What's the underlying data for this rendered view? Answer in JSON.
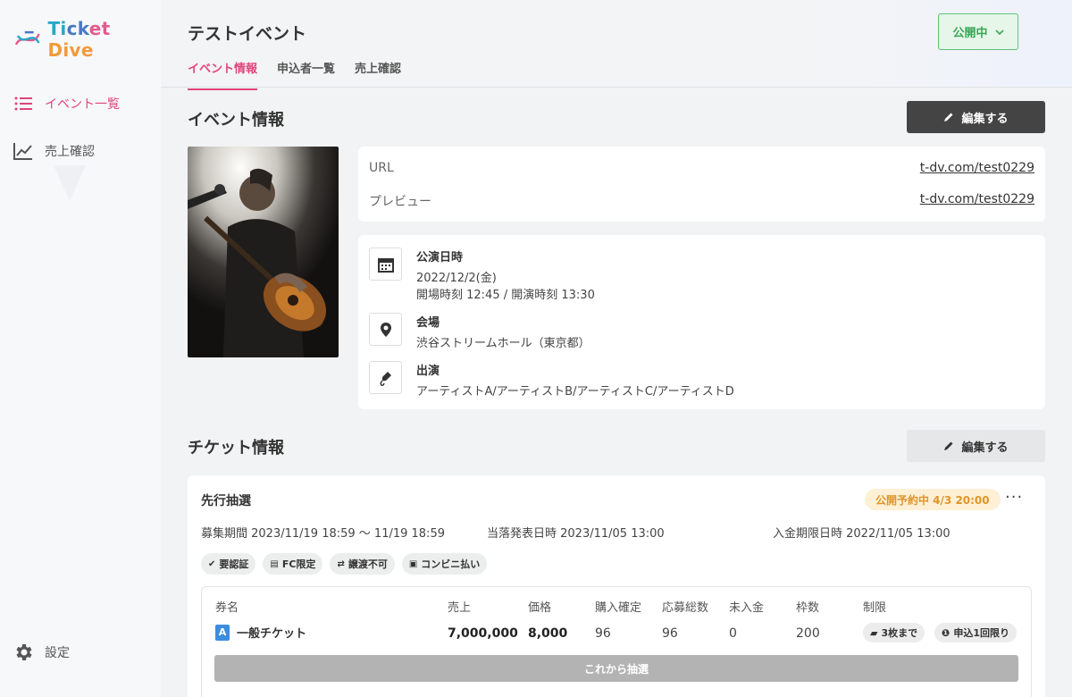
{
  "brand": {
    "name_parts": [
      "Ti",
      "ck",
      "et ",
      "Dive"
    ]
  },
  "sidebar": {
    "items": [
      {
        "label": "イベント一覧",
        "icon": "list-icon",
        "active": true
      },
      {
        "label": "売上確認",
        "icon": "chart-line-icon",
        "active": false
      }
    ],
    "settings_label": "設定"
  },
  "header": {
    "title": "テストイベント",
    "status_label": "公開中",
    "tabs": [
      {
        "label": "イベント情報",
        "active": true
      },
      {
        "label": "申込者一覧",
        "active": false
      },
      {
        "label": "売上確認",
        "active": false
      }
    ]
  },
  "event_info": {
    "section_title": "イベント情報",
    "edit_label": "編集する",
    "url_label": "URL",
    "url_value": "t-dv.com/test0229",
    "preview_label": "プレビュー",
    "preview_value": "t-dv.com/test0229",
    "date_title": "公演日時",
    "date_value": "2022/12/2(金)",
    "time_value": "開場時刻 12:45 / 開演時刻 13:30",
    "venue_title": "会場",
    "venue_value": "渋谷ストリームホール（東京都）",
    "cast_title": "出演",
    "cast_value": "アーティストA/アーティストB/アーティストC/アーティストD"
  },
  "ticket_info": {
    "section_title": "チケット情報",
    "edit_label": "編集する",
    "card": {
      "title": "先行抽選",
      "schedule_badge": "公開予約中 4/3 20:00",
      "more_label": "···",
      "recruit_period": "募集期間  2023/11/19 18:59 〜 11/19 18:59",
      "announce_date": "当落発表日時  2023/11/05 13:00",
      "payment_deadline": "入金期限日時  2022/11/05 13:00",
      "tags": [
        "要認証",
        "FC限定",
        "譲渡不可",
        "コンビニ払い"
      ],
      "columns": [
        "券名",
        "売上",
        "価格",
        "購入確定",
        "応募総数",
        "未入金",
        "枠数",
        "制限"
      ],
      "row": {
        "letter": "A",
        "name": "一般チケット",
        "sales": "7,000,000",
        "price": "8,000",
        "confirmed": "96",
        "applications": "96",
        "unpaid": "0",
        "slots": "200",
        "limits": [
          "3枚まで",
          "申込1回限り"
        ]
      },
      "lottery_label": "これから抽選"
    }
  },
  "colors": {
    "accent": "#e0457b",
    "published": "#3aa556",
    "scheduled": "#e0952a"
  }
}
